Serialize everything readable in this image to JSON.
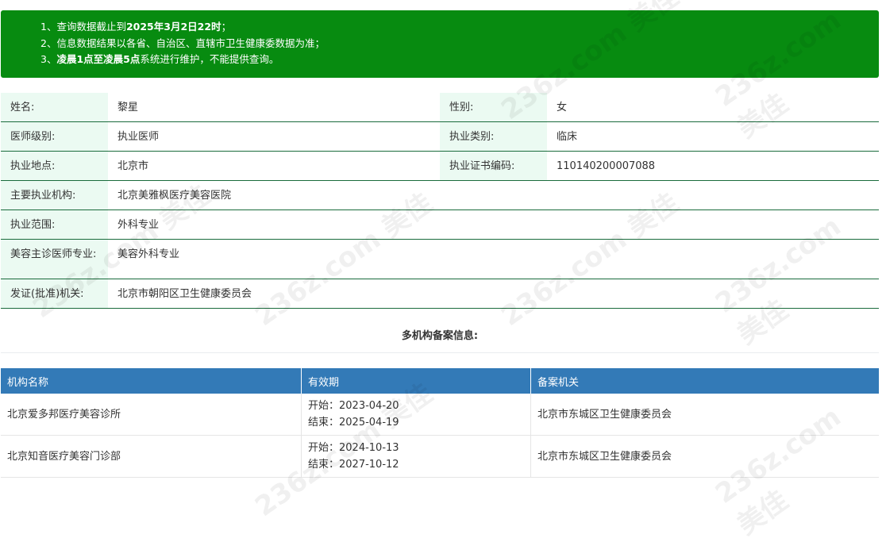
{
  "notice": {
    "line1_prefix": "1、查询数据截止到",
    "line1_bold": "2025年3月2日22时",
    "line1_suffix": "；",
    "line2": "2、信息数据结果以各省、自治区、直辖市卫生健康委数据为准；",
    "line3_prefix": "3、",
    "line3_bold": "凌晨1点至凌晨5点",
    "line3_suffix": "系统进行维护，不能提供查询。"
  },
  "info": {
    "name_label": "姓名:",
    "name_value": "黎星",
    "gender_label": "性别:",
    "gender_value": "女",
    "level_label": "医师级别:",
    "level_value": "执业医师",
    "category_label": "执业类别:",
    "category_value": "临床",
    "location_label": "执业地点:",
    "location_value": "北京市",
    "cert_label": "执业证书编码:",
    "cert_value": "110140200007088",
    "org_label": "主要执业机构:",
    "org_value": "北京美雅枫医疗美容医院",
    "scope_label": "执业范围:",
    "scope_value": "外科专业",
    "cosmetic_label": "美容主诊医师专业:",
    "cosmetic_value": "美容外科专业",
    "issuer_label": "发证(批准)机关:",
    "issuer_value": "北京市朝阳区卫生健康委员会"
  },
  "records": {
    "title": "多机构备案信息:",
    "headers": [
      "机构名称",
      "有效期",
      "备案机关"
    ],
    "rows": [
      {
        "org": "北京爱多邦医疗美容诊所",
        "start": "开始：2023-04-20",
        "end": "结束：2025-04-19",
        "authority": "北京市东城区卫生健康委员会"
      },
      {
        "org": "北京知音医疗美容门诊部",
        "start": "开始：2024-10-13",
        "end": "结束：2027-10-12",
        "authority": "北京市东城区卫生健康委员会"
      }
    ]
  },
  "watermark": {
    "text": "236z.com 美佳"
  }
}
